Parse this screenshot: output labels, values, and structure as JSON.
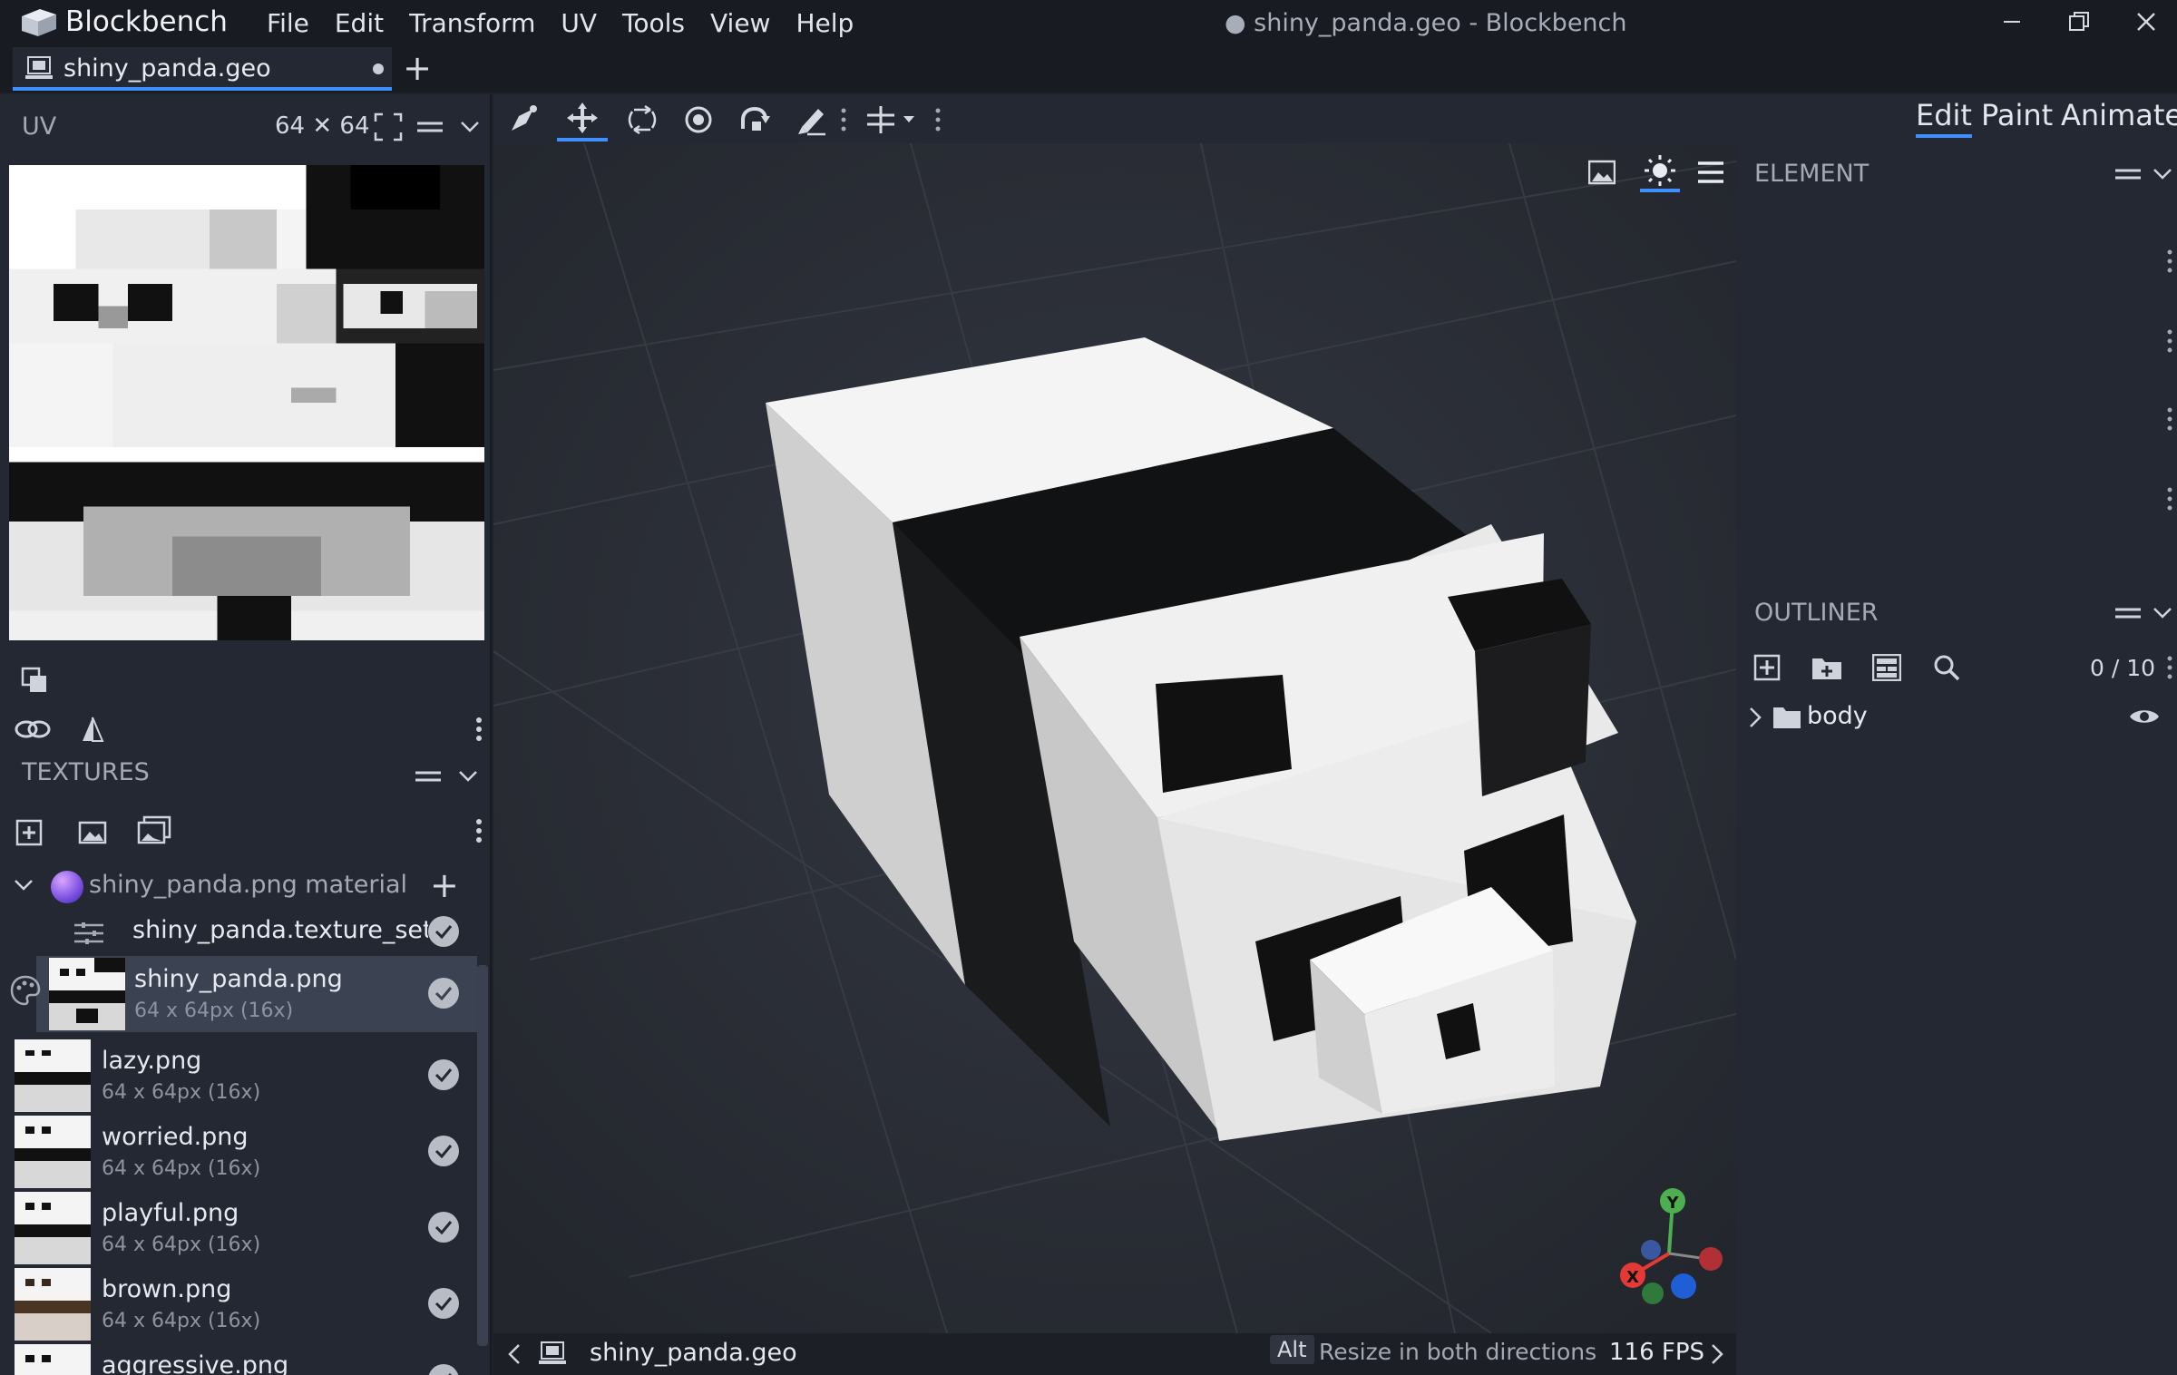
{
  "app": {
    "name": "Blockbench",
    "window_title": "● shiny_panda.geo - Blockbench",
    "menu": [
      "File",
      "Edit",
      "Transform",
      "UV",
      "Tools",
      "View",
      "Help"
    ]
  },
  "tab": {
    "label": "shiny_panda.geo",
    "add": "+"
  },
  "uv": {
    "title": "UV",
    "size": "64 ✕ 64"
  },
  "textures": {
    "title": "TEXTURES",
    "material": {
      "label": "shiny_panda.png material",
      "add": "+"
    },
    "texture_set": {
      "label": "shiny_panda.texture_set.json"
    },
    "items": [
      {
        "name": "shiny_panda.png",
        "meta": "64 x 64px (16x)",
        "selected": true
      },
      {
        "name": "lazy.png",
        "meta": "64 x 64px (16x)"
      },
      {
        "name": "worried.png",
        "meta": "64 x 64px (16x)"
      },
      {
        "name": "playful.png",
        "meta": "64 x 64px (16x)"
      },
      {
        "name": "brown.png",
        "meta": "64 x 64px (16x)"
      },
      {
        "name": "aggressive.png",
        "meta": ""
      }
    ]
  },
  "modes": {
    "edit": "Edit",
    "paint": "Paint",
    "animate": "Animate"
  },
  "element_panel": {
    "title": "ELEMENT"
  },
  "outliner": {
    "title": "OUTLINER",
    "count": "0 / 10",
    "items": [
      {
        "label": "body"
      }
    ]
  },
  "statusbar": {
    "file": "shiny_panda.geo",
    "key": "Alt",
    "hint": "Resize in both directions",
    "fps": "116 FPS"
  },
  "gizmo": {
    "x": "X",
    "y": "Y"
  },
  "colors": {
    "accent": "#3e90ff",
    "panel": "#242832",
    "titlebar": "#191b22",
    "viewport": "#2a2d34"
  }
}
